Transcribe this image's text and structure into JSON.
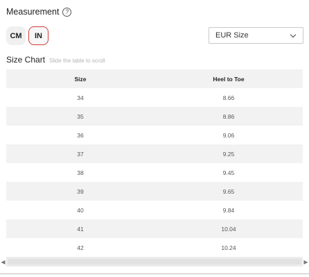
{
  "measurement": {
    "title": "Measurement",
    "help_icon": "question-circle-icon"
  },
  "units": {
    "cm_label": "CM",
    "in_label": "IN",
    "selected": "IN",
    "accent": "#d23a3a"
  },
  "size_select": {
    "value": "EUR Size"
  },
  "size_chart": {
    "title": "Size Chart",
    "hint": "Slide the table to scroll"
  },
  "table": {
    "headers": [
      "Size",
      "Heel to Toe"
    ],
    "rows": [
      [
        "34",
        "8.66"
      ],
      [
        "35",
        "8.86"
      ],
      [
        "36",
        "9.06"
      ],
      [
        "37",
        "9.25"
      ],
      [
        "38",
        "9.45"
      ],
      [
        "39",
        "9.65"
      ],
      [
        "40",
        "9.84"
      ],
      [
        "41",
        "10.04"
      ],
      [
        "42",
        "10.24"
      ]
    ]
  }
}
